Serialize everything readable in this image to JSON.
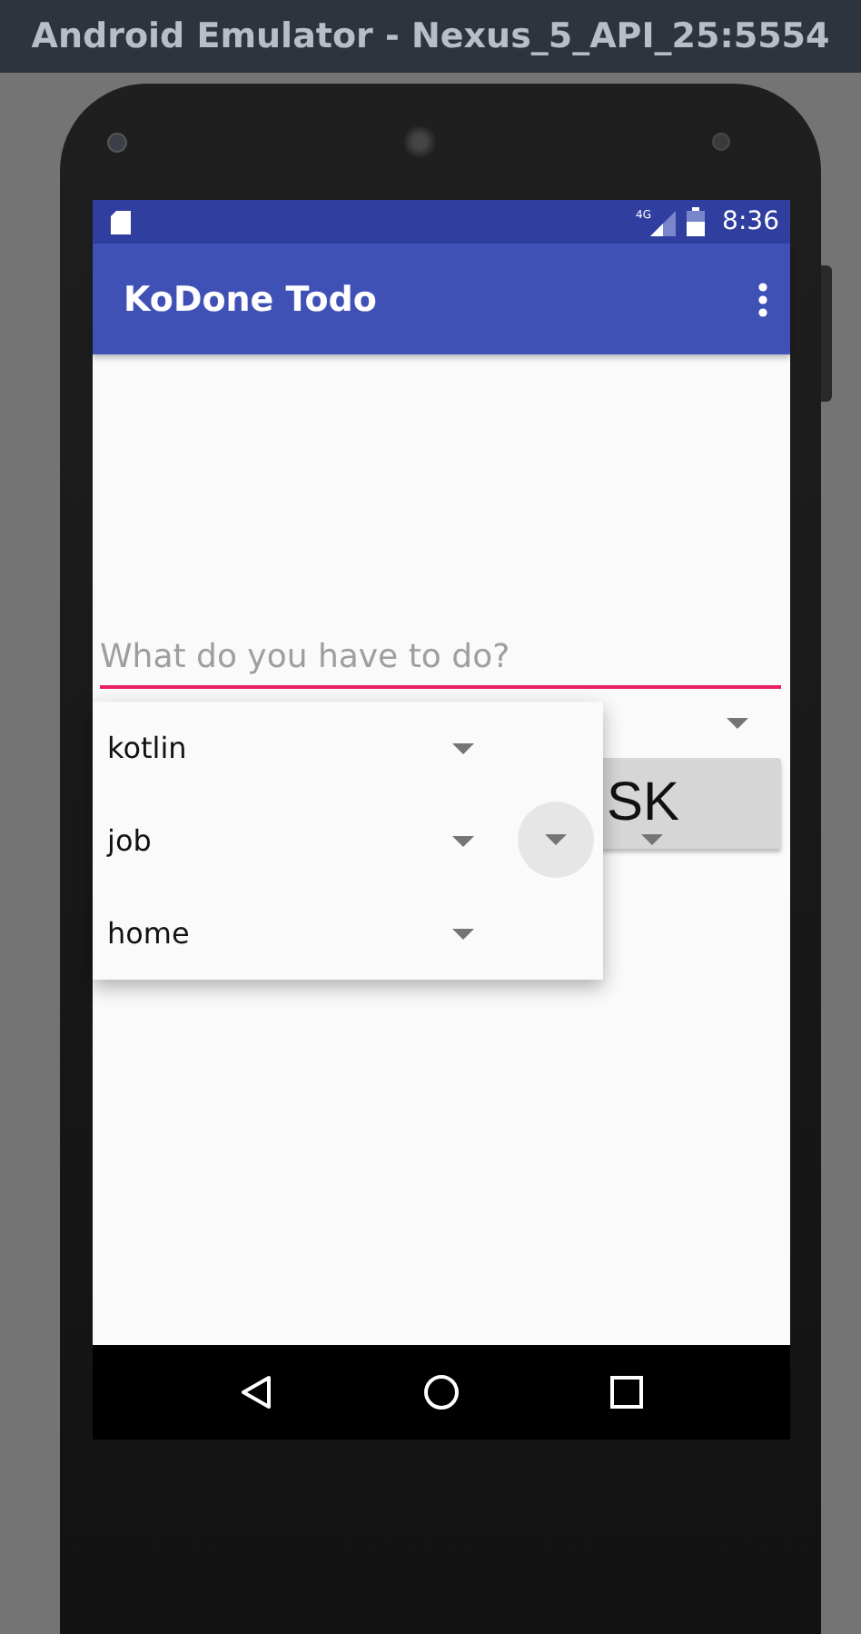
{
  "window": {
    "title": "Android Emulator - Nexus_5_API_25:5554"
  },
  "status_bar": {
    "time": "8:36",
    "network": "4G"
  },
  "app_bar": {
    "title": "KoDone Todo"
  },
  "task_field": {
    "placeholder": "What do you have to do?"
  },
  "add_button": {
    "label": "SK"
  },
  "dropdown": {
    "items": [
      {
        "label": "kotlin",
        "pressed": false
      },
      {
        "label": "job",
        "pressed": true
      },
      {
        "label": "home",
        "pressed": false
      }
    ]
  }
}
